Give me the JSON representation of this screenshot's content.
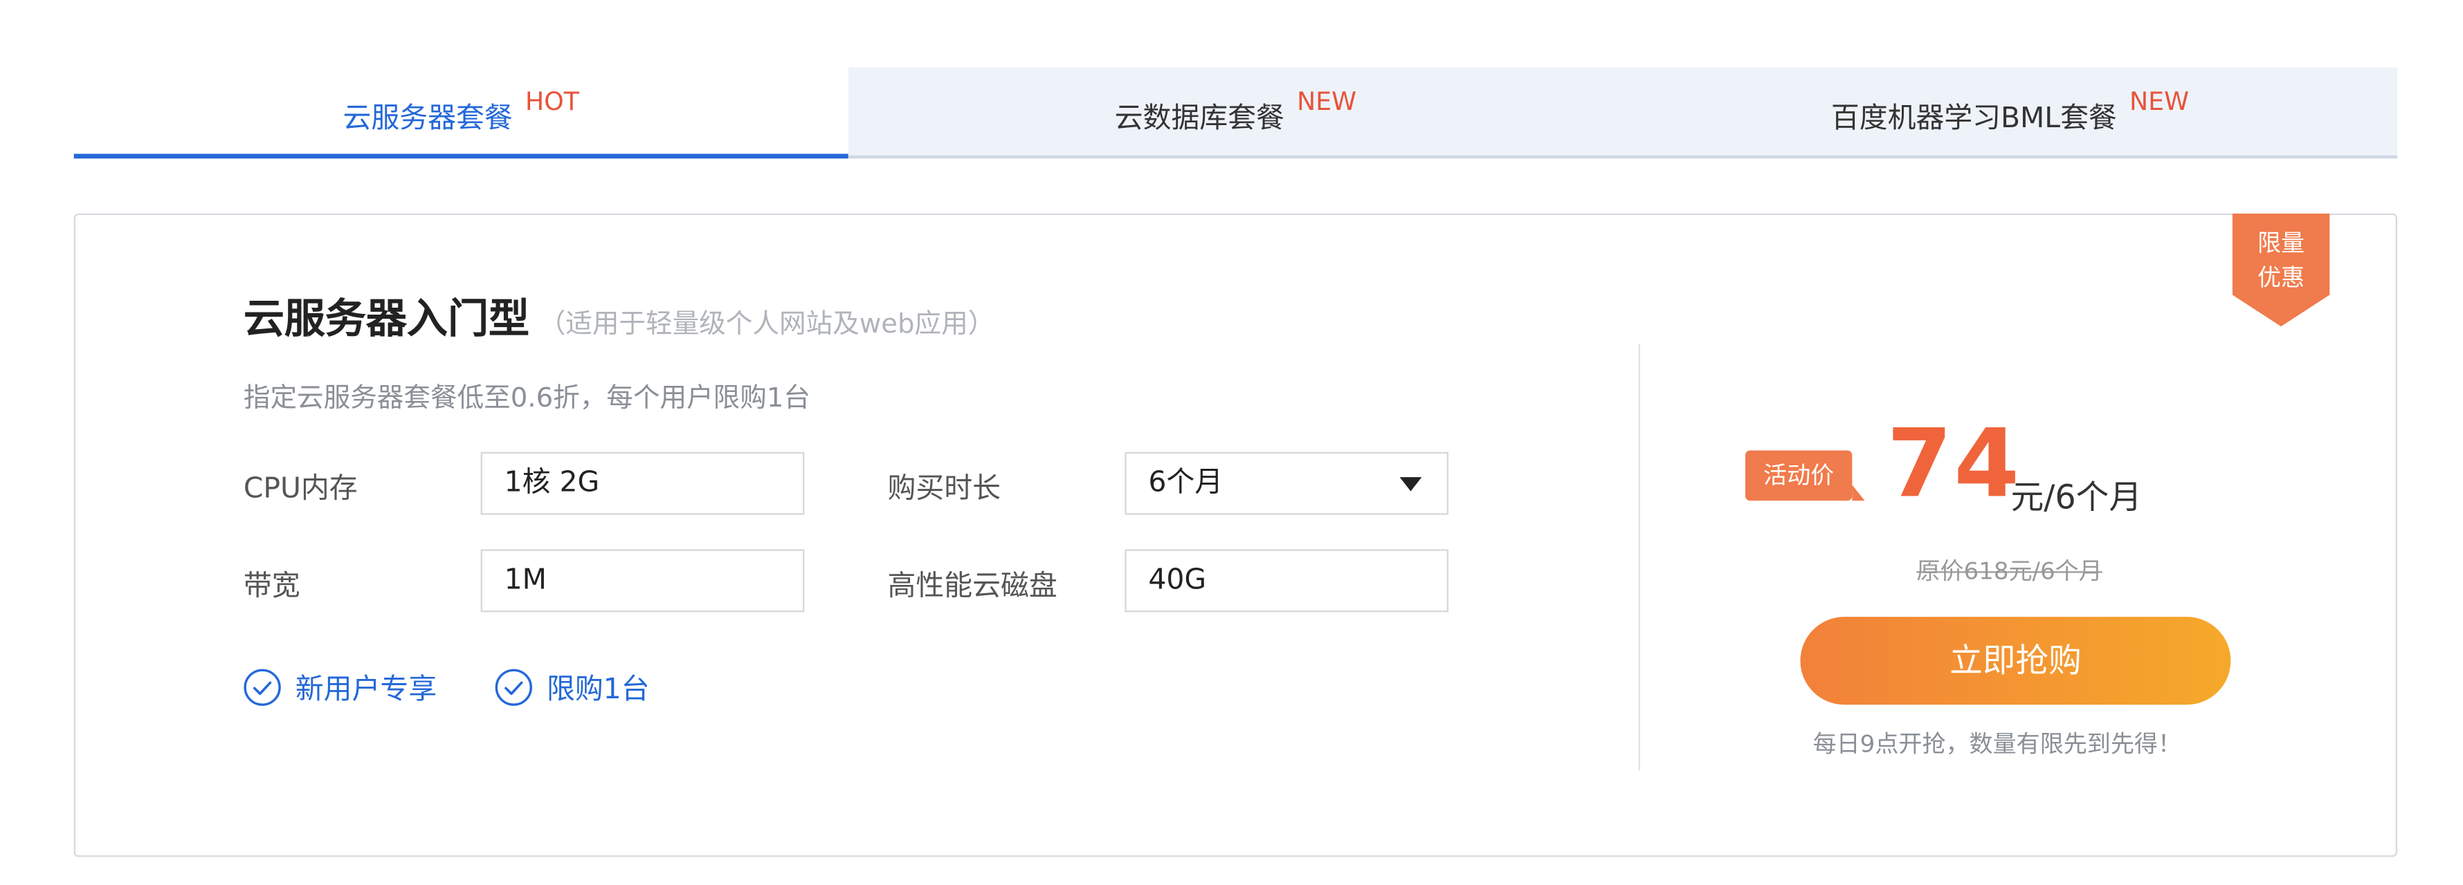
{
  "tabs": [
    {
      "label": "云服务器套餐",
      "badge": "HOT",
      "active": true
    },
    {
      "label": "云数据库套餐",
      "badge": "NEW",
      "active": false
    },
    {
      "label": "百度机器学习BML套餐",
      "badge": "NEW",
      "active": false
    }
  ],
  "ribbon": {
    "line1": "限量",
    "line2": "优惠"
  },
  "plan": {
    "title": "云服务器入门型",
    "subtitle": "（适用于轻量级个人网站及web应用）",
    "description": "指定云服务器套餐低至0.6折，每个用户限购1台"
  },
  "form": {
    "cpu_label": "CPU内存",
    "cpu_value": "1核 2G",
    "duration_label": "购买时长",
    "duration_value": "6个月",
    "bandwidth_label": "带宽",
    "bandwidth_value": "1M",
    "disk_label": "高性能云磁盘",
    "disk_value": "40G"
  },
  "perks": [
    "新用户专享",
    "限购1台"
  ],
  "pricing": {
    "activity_label": "活动价",
    "price": "74",
    "unit": "元/6个月",
    "original": "原价618元/6个月",
    "buy_label": "立即抢购",
    "note": "每日9点开抢，数量有限先到先得！"
  },
  "colors": {
    "accent": "#2468d8",
    "promo": "#f0643c",
    "button_start": "#f2813a",
    "button_end": "#f5a92a"
  }
}
